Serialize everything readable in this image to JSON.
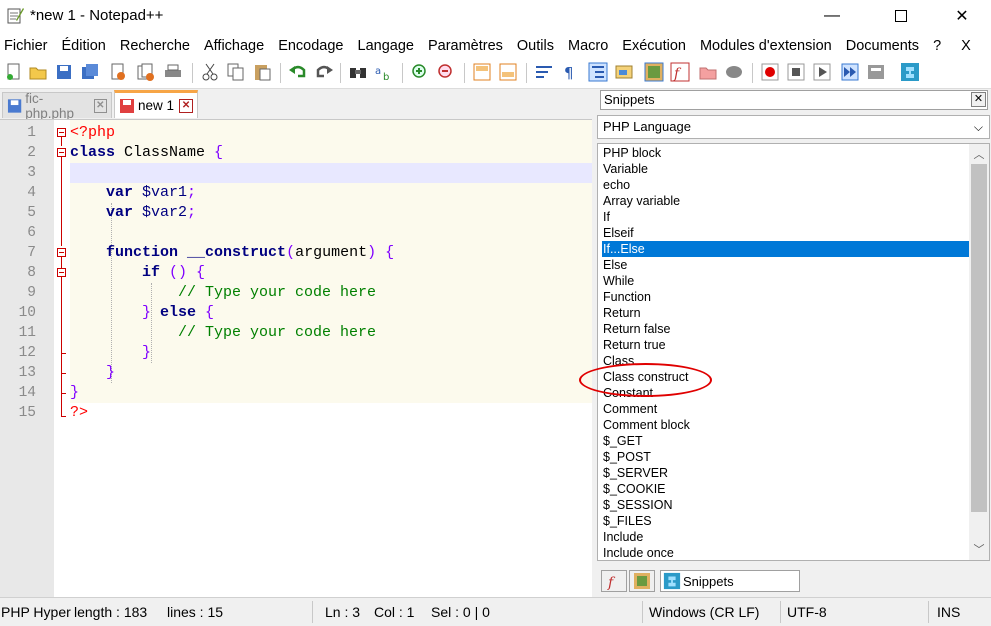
{
  "window": {
    "title": "*new 1 - Notepad++",
    "minimize_icon": "minimize-icon",
    "maximize_icon": "maximize-icon",
    "close_icon": "close-icon"
  },
  "menu": [
    "Fichier",
    "Édition",
    "Recherche",
    "Affichage",
    "Encodage",
    "Langage",
    "Paramètres",
    "Outils",
    "Macro",
    "Exécution",
    "Modules d'extension",
    "Documents",
    "?",
    "X"
  ],
  "tabs": [
    {
      "label": "fic-php.php",
      "active": false
    },
    {
      "label": "new 1",
      "active": true
    }
  ],
  "editor": {
    "line_numbers": [
      "1",
      "2",
      "3",
      "4",
      "5",
      "6",
      "7",
      "8",
      "9",
      "10",
      "11",
      "12",
      "13",
      "14",
      "15"
    ],
    "current_line": 3
  },
  "code": {
    "l1_open": "<?php",
    "l2_kw": "class",
    "l2_name": " ClassName ",
    "l2_brace": "{",
    "l4_kw": "var",
    "l4_var": " $var1",
    "l4_semi": ";",
    "l5_kw": "var",
    "l5_var": " $var2",
    "l5_semi": ";",
    "l7_kw": "function",
    "l7_name": " __construct",
    "l7_paren": "(",
    "l7_arg": "argument",
    "l7_close": ") {",
    "l8_kw": "if",
    "l8_rest": " () {",
    "l9_comment": "// Type your code here",
    "l10_brace": "}",
    "l10_kw": " else",
    "l10_open": " {",
    "l11_comment": "// Type your code here",
    "l12_brace": "}",
    "l13_brace": "}",
    "l14_brace": "}",
    "l15_close": "?>"
  },
  "snippets": {
    "title": "Snippets",
    "language": "PHP Language",
    "selected": "If...Else",
    "items": [
      "PHP block",
      "Variable",
      "echo",
      "Array variable",
      "If",
      "Elseif",
      "If...Else",
      "Else",
      "While",
      "Function",
      "Return",
      "Return false",
      "Return true",
      "Class",
      "Class construct",
      "Constant",
      "Comment",
      "Comment block",
      "$_GET",
      "$_POST",
      "$_SERVER",
      "$_COOKIE",
      "$_SESSION",
      "$_FILES",
      "Include",
      "Include once"
    ],
    "bottom_tab_label": "Snippets"
  },
  "status": {
    "lang": "PHP Hyper",
    "length": "length : 183",
    "lines": "lines : 15",
    "ln": "Ln : 3",
    "col": "Col : 1",
    "sel": "Sel : 0 | 0",
    "eol": "Windows (CR LF)",
    "encoding": "UTF-8",
    "mode": "INS"
  },
  "colors": {
    "accent_selected": "#0078d7",
    "annotation_circle": "#e00000",
    "tab_active_top": "#f7a546"
  }
}
